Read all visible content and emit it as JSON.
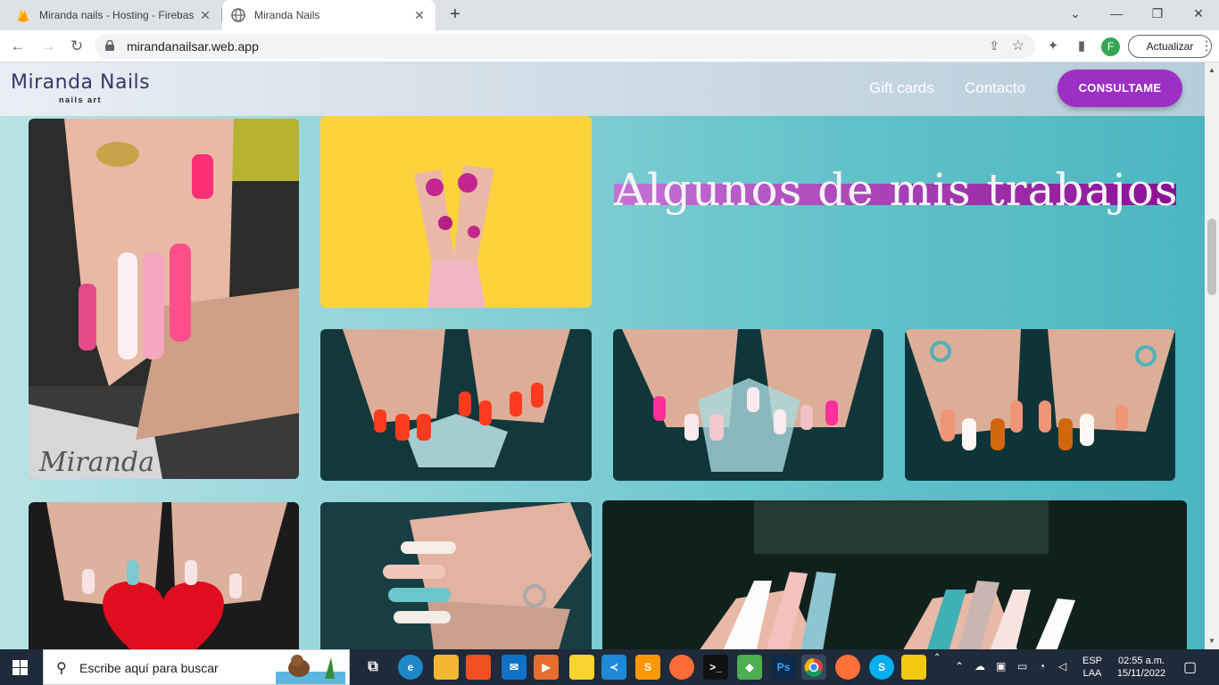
{
  "browser": {
    "tabs": [
      {
        "title": "Miranda nails - Hosting - Firebas",
        "active": false
      },
      {
        "title": "Miranda Nails",
        "active": true
      }
    ],
    "url": "mirandanailsar.web.app",
    "update_label": "Actualizar",
    "profile_initial": "F"
  },
  "site": {
    "logo_title": "Miranda Nails",
    "logo_subtitle": "nails art",
    "nav": [
      "Gift cards",
      "Contacto"
    ],
    "cta_label": "CONSULTAME",
    "heading": "Algunos de mis trabajos",
    "colors": {
      "accent": "#9c2fc4",
      "heading_bar": "#8a0f94",
      "background": "#62c2ca"
    }
  },
  "taskbar": {
    "search_placeholder": "Escribe aquí para buscar",
    "lang_top": "ESP",
    "lang_bottom": "LAA",
    "time": "02:55 a.m.",
    "date": "15/11/2022",
    "apps": [
      "task-view",
      "edge",
      "file-explorer",
      "store",
      "mail",
      "media-player",
      "sticky-notes",
      "vscode",
      "sublime-text",
      "postman",
      "terminal",
      "git",
      "photoshop",
      "chrome",
      "firefox",
      "skype",
      "power-bi"
    ]
  }
}
